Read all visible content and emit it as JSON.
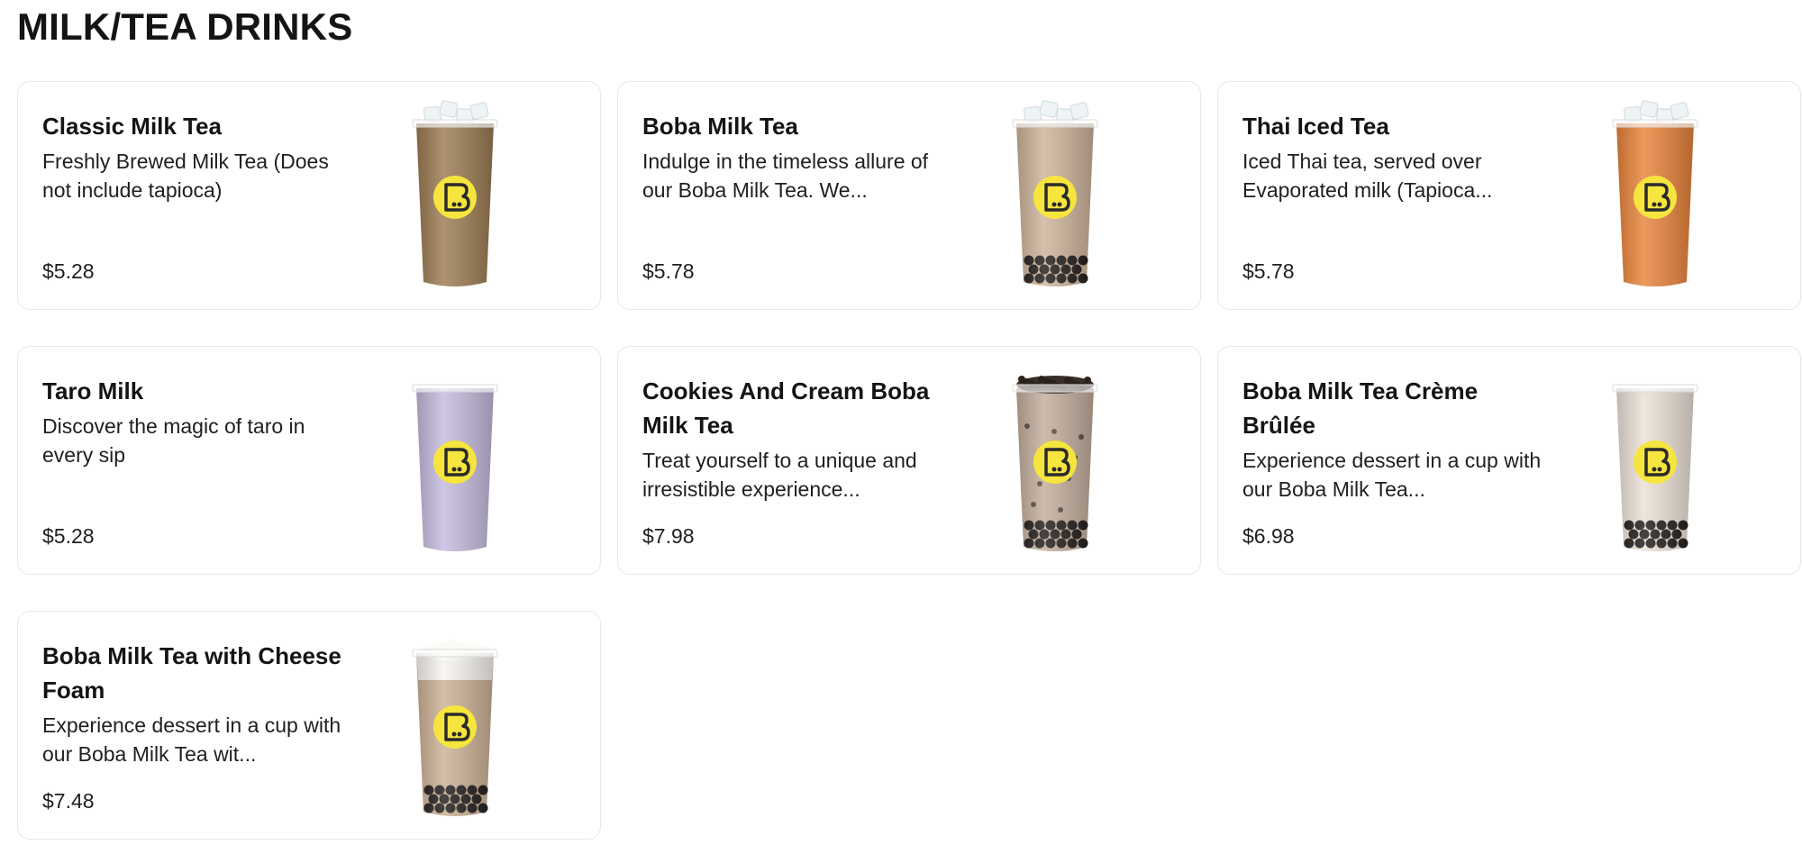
{
  "section": {
    "title": "MILK/TEA DRINKS"
  },
  "items": [
    {
      "name": "Classic Milk Tea",
      "description": "Freshly Brewed Milk Tea (Does not include tapioca)",
      "price": "$5.28",
      "image": {
        "icon": "milk-tea-cup-icon",
        "drink_color": "#9b7b52",
        "topping": "ice",
        "pearls": false
      }
    },
    {
      "name": "Boba Milk Tea",
      "description": "Indulge in the timeless allure of our Boba Milk Tea. We...",
      "price": "$5.78",
      "image": {
        "icon": "boba-milk-tea-cup-icon",
        "drink_color": "#cdb39a",
        "topping": "ice",
        "pearls": true
      }
    },
    {
      "name": "Thai Iced Tea",
      "description": "Iced Thai tea, served over Evaporated milk (Tapioca...",
      "price": "$5.78",
      "image": {
        "icon": "thai-tea-cup-icon",
        "drink_color": "#e8833a",
        "topping": "ice",
        "pearls": false
      }
    },
    {
      "name": "Taro Milk",
      "description": "Discover the magic of taro in every sip",
      "price": "$5.28",
      "image": {
        "icon": "taro-milk-cup-icon",
        "drink_color": "#c4b9dc",
        "topping": "none",
        "pearls": false
      }
    },
    {
      "name": "Cookies And Cream Boba Milk Tea",
      "description": "Treat yourself to a unique and irresistible experience...",
      "price": "$7.98",
      "image": {
        "icon": "cookies-cream-cup-icon",
        "drink_color": "#c2ad9c",
        "topping": "cookie",
        "pearls": true
      }
    },
    {
      "name": "Boba Milk Tea Crème Brûlée",
      "description": "Experience dessert in a cup with our Boba Milk Tea...",
      "price": "$6.98",
      "image": {
        "icon": "creme-brulee-cup-icon",
        "drink_color": "#ebe1d6",
        "topping": "none",
        "pearls": true
      }
    },
    {
      "name": "Boba Milk Tea with Cheese Foam",
      "description": "Experience dessert in a cup with our Boba Milk Tea wit...",
      "price": "$7.48",
      "image": {
        "icon": "cheese-foam-cup-icon",
        "drink_color": "#cbb095",
        "topping": "foam",
        "pearls": true
      }
    }
  ],
  "brand": {
    "logo_color": "#f6e53e",
    "logo_ink": "#2b2b2b"
  }
}
